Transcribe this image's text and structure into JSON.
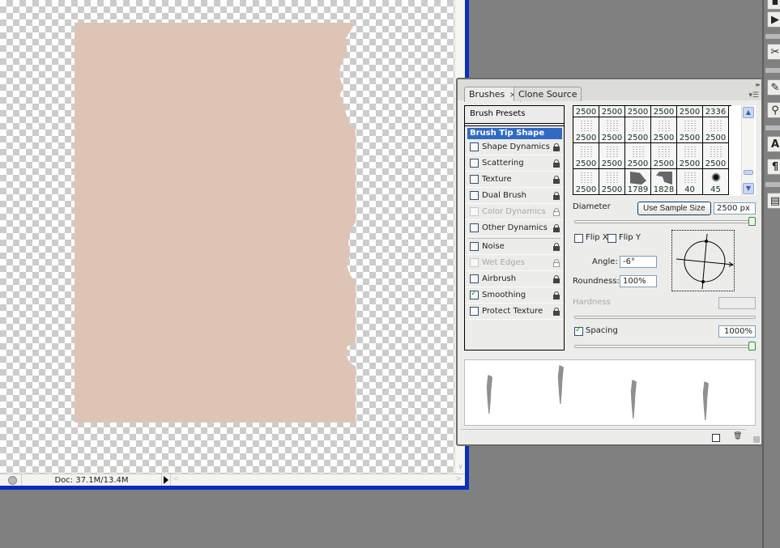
{
  "document": {
    "status_text": "Doc: 37.1M/13.4M",
    "artwork_color": "#dfc4b6"
  },
  "brushes_panel": {
    "tabs": [
      {
        "label": "Brushes",
        "active": true,
        "closable": true
      },
      {
        "label": "Clone Source",
        "active": false
      }
    ],
    "close_glyph": "×",
    "collapse_glyph": "▸▸",
    "menu_glyph": "▾☰",
    "brush_presets_label": "Brush Presets",
    "brush_tip_shape_label": "Brush Tip Shape",
    "options_group1": [
      {
        "label": "Shape Dynamics",
        "checked": false,
        "enabled": true
      },
      {
        "label": "Scattering",
        "checked": false,
        "enabled": true
      },
      {
        "label": "Texture",
        "checked": false,
        "enabled": true
      },
      {
        "label": "Dual Brush",
        "checked": false,
        "enabled": true
      },
      {
        "label": "Color Dynamics",
        "checked": false,
        "enabled": false
      },
      {
        "label": "Other Dynamics",
        "checked": false,
        "enabled": true
      }
    ],
    "options_group2": [
      {
        "label": "Noise",
        "checked": false,
        "enabled": true
      },
      {
        "label": "Wet Edges",
        "checked": false,
        "enabled": false
      },
      {
        "label": "Airbrush",
        "checked": false,
        "enabled": true
      },
      {
        "label": "Smoothing",
        "checked": true,
        "enabled": true
      },
      {
        "label": "Protect Texture",
        "checked": false,
        "enabled": true
      }
    ],
    "tip_sizes": [
      [
        "2500",
        "2500",
        "2500",
        "2500",
        "2500",
        "2336"
      ],
      [
        "2500",
        "2500",
        "2500",
        "2500",
        "2500",
        "2500"
      ],
      [
        "2500",
        "2500",
        "2500",
        "2500",
        "2500",
        "2500"
      ],
      [
        "2500",
        "2500",
        "1789",
        "1828",
        "40",
        "45"
      ]
    ],
    "settings": {
      "diameter_label": "Diameter",
      "use_sample_size_label": "Use Sample Size",
      "diameter_value": "2500 px",
      "diameter_slider_fraction": 1.0,
      "flip_x_label": "Flip X",
      "flip_x_checked": false,
      "flip_y_label": "Flip Y",
      "flip_y_checked": false,
      "angle_label": "Angle:",
      "angle_value": "-6°",
      "roundness_label": "Roundness:",
      "roundness_value": "100%",
      "hardness_label": "Hardness",
      "hardness_value": "",
      "spacing_label": "Spacing",
      "spacing_checked": true,
      "spacing_value": "1000%",
      "spacing_slider_fraction": 1.0
    }
  },
  "right_dock": {
    "tools": [
      "play-icon",
      "tools-icon",
      "brush-icon",
      "clone-stamp-icon",
      "text-icon",
      "paragraph-icon",
      "layer-comps-icon"
    ],
    "text_glyph": "A",
    "paragraph_glyph": "¶"
  }
}
